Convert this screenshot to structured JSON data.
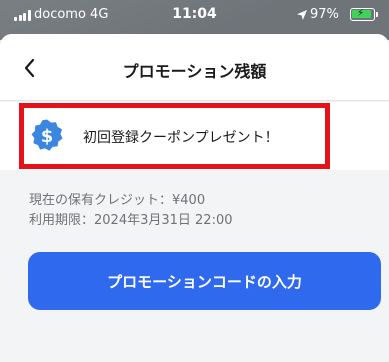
{
  "status_bar": {
    "carrier": "docomo  4G",
    "time": "11:04",
    "battery": "97%",
    "battery_level": 0.97,
    "icons": [
      "signal-bars-icon",
      "location-arrow-icon",
      "battery-charging-icon"
    ]
  },
  "header": {
    "back_icon": "chevron-left-icon",
    "title": "プロモーション残額"
  },
  "promotion": {
    "icon": "dollar-badge-icon",
    "label": "初回登録クーポンプレゼント！",
    "highlight_color": "#e5121a"
  },
  "credit": {
    "balance": "現在の保有クレジット：¥400",
    "expiry": "利用期限：2024年3月31日 22:00"
  },
  "actions": {
    "promo_code_button": "プロモーションコードの入力",
    "button_color": "#2f69ee"
  },
  "colors": {
    "badge": "#3a86e0",
    "sheet_background": "#f3f4f6"
  }
}
